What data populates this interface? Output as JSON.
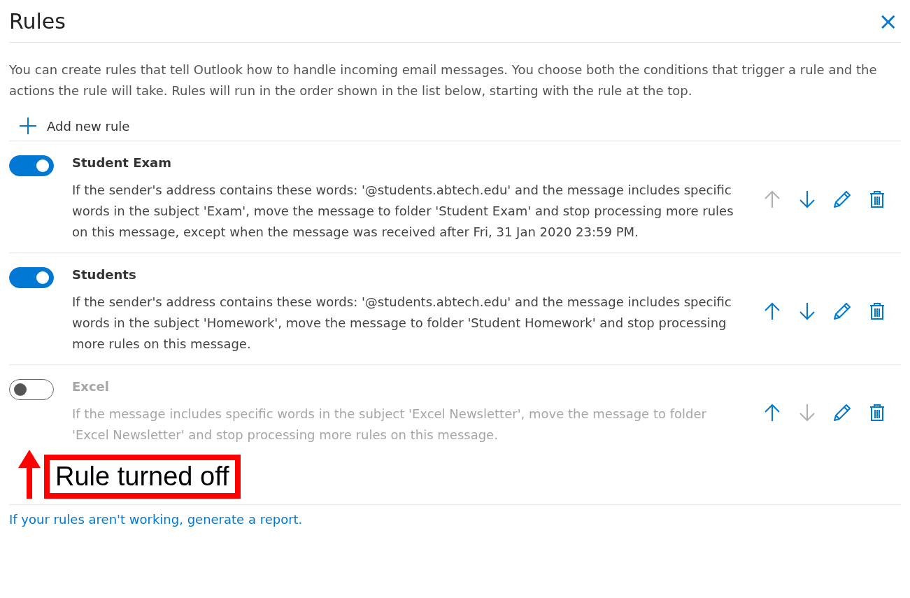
{
  "title": "Rules",
  "close": "×",
  "description": "You can create rules that tell Outlook how to handle incoming email messages. You choose both the conditions that trigger a rule and the actions the rule will take. Rules will run in the order shown in the list below, starting with the rule at the top.",
  "add_button": {
    "label": "Add new rule"
  },
  "rules": [
    {
      "name": "Student Exam",
      "on": true,
      "text": "If the sender's address contains these words: '@students.abtech.edu' and the message includes specific words in the subject 'Exam', move the message to folder 'Student Exam' and stop processing more rules on this message, except when the message was received after Fri, 31 Jan 2020 23:59 PM.",
      "actions": [
        {
          "kind": "up",
          "disabled": true
        },
        {
          "kind": "down",
          "disabled": false
        },
        {
          "kind": "edit",
          "disabled": false
        },
        {
          "kind": "delete",
          "disabled": false
        }
      ]
    },
    {
      "name": "Students",
      "on": true,
      "text": "If the sender's address contains these words: '@students.abtech.edu' and the message includes specific words in the subject 'Homework', move the message to folder 'Student Homework' and stop processing more rules on this message.",
      "actions": [
        {
          "kind": "up",
          "disabled": false
        },
        {
          "kind": "down",
          "disabled": false
        },
        {
          "kind": "edit",
          "disabled": false
        },
        {
          "kind": "delete",
          "disabled": false
        }
      ]
    },
    {
      "name": "Excel",
      "on": false,
      "text": "If the message includes specific words in the subject 'Excel Newsletter', move the message to folder 'Excel Newsletter' and stop processing more rules on this message.",
      "actions": [
        {
          "kind": "up",
          "disabled": false
        },
        {
          "kind": "down",
          "disabled": true
        },
        {
          "kind": "edit",
          "disabled": false
        },
        {
          "kind": "delete",
          "disabled": false
        }
      ]
    }
  ],
  "callout": "Rule turned off",
  "report_link": "If your rules aren't working, generate a report."
}
